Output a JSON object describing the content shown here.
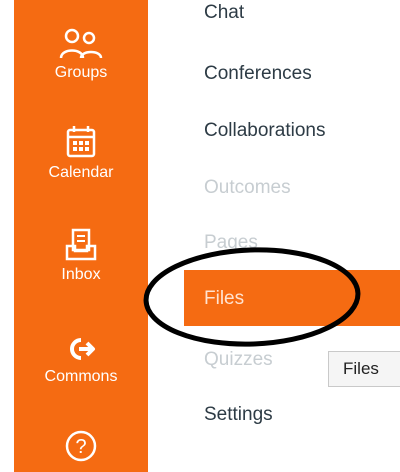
{
  "global_nav": {
    "items": [
      {
        "label": "Groups",
        "icon": "groups-icon"
      },
      {
        "label": "Calendar",
        "icon": "calendar-icon"
      },
      {
        "label": "Inbox",
        "icon": "inbox-icon"
      },
      {
        "label": "Commons",
        "icon": "commons-icon"
      },
      {
        "label": "",
        "icon": "help-icon"
      }
    ],
    "color": "#f56b12"
  },
  "course_nav": {
    "items": [
      {
        "label": "Chat",
        "state": "partially-visible"
      },
      {
        "label": "Conferences",
        "state": "enabled"
      },
      {
        "label": "Collaborations",
        "state": "enabled"
      },
      {
        "label": "Outcomes",
        "state": "disabled"
      },
      {
        "label": "Pages",
        "state": "disabled"
      },
      {
        "label": "Files",
        "state": "active"
      },
      {
        "label": "Quizzes",
        "state": "disabled"
      },
      {
        "label": "Settings",
        "state": "enabled"
      }
    ],
    "active_color": "#f56b12",
    "disabled_color": "#c7cdd1"
  },
  "tooltip": {
    "text": "Files"
  },
  "annotation": {
    "shape": "ellipse",
    "color": "#000000"
  }
}
